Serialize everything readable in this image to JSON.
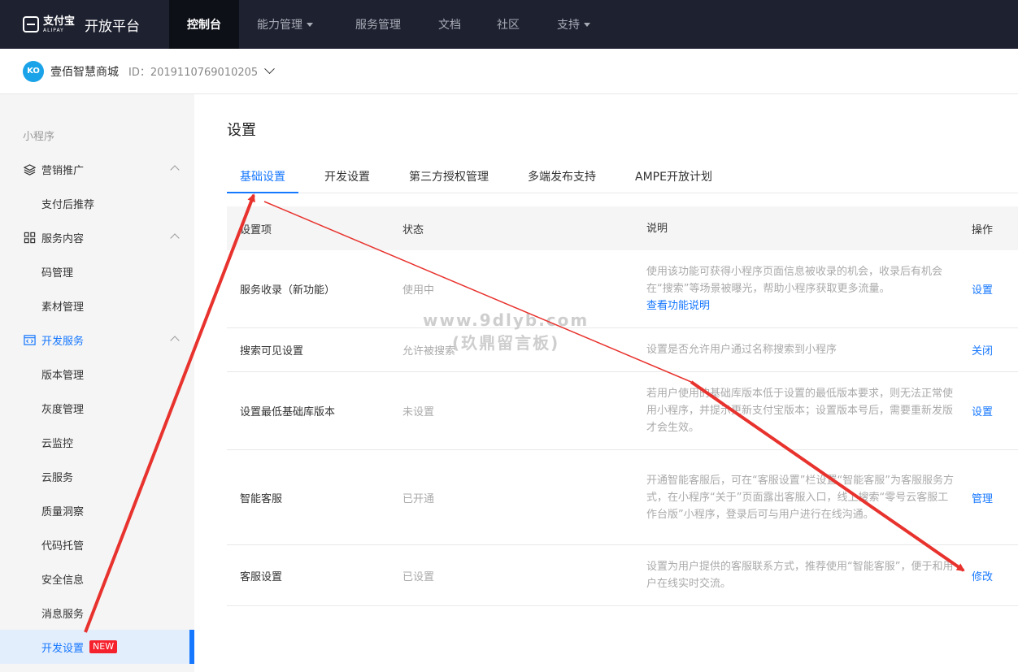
{
  "topnav": {
    "logo_cn": "支付宝",
    "logo_en": "ALIPAY",
    "platform_title": "开放平台",
    "items": [
      {
        "label": "控制台",
        "active": true,
        "dropdown": false
      },
      {
        "label": "能力管理",
        "active": false,
        "dropdown": true
      },
      {
        "label": "服务管理",
        "active": false,
        "dropdown": false
      },
      {
        "label": "文档",
        "active": false,
        "dropdown": false
      },
      {
        "label": "社区",
        "active": false,
        "dropdown": false
      },
      {
        "label": "支持",
        "active": false,
        "dropdown": true
      }
    ]
  },
  "appbar": {
    "avatar": "KO",
    "name": "壹佰智慧商城",
    "id": "ID：2019110769010205"
  },
  "sidebar": {
    "section": "小程序",
    "groups": [
      {
        "label": "营销推广",
        "items": [
          "支付后推荐"
        ]
      },
      {
        "label": "服务内容",
        "items": [
          "码管理",
          "素材管理"
        ]
      },
      {
        "label": "开发服务",
        "items": [
          "版本管理",
          "灰度管理",
          "云监控",
          "云服务",
          "质量洞察",
          "代码托管",
          "安全信息",
          "消息服务"
        ]
      }
    ],
    "active_item": "开发设置",
    "active_badge": "NEW"
  },
  "main": {
    "title": "设置",
    "tabs": [
      "基础设置",
      "开发设置",
      "第三方授权管理",
      "多端发布支持",
      "AMPE开放计划"
    ],
    "table": {
      "headers": [
        "设置项",
        "状态",
        "说明",
        "操作"
      ],
      "rows": [
        {
          "item": "服务收录（新功能）",
          "status": "使用中",
          "desc": "使用该功能可获得小程序页面信息被收录的机会，收录后有机会在“搜索”等场景被曝光，帮助小程序获取更多流量。",
          "desc_link": "查看功能说明",
          "action": "设置"
        },
        {
          "item": "搜索可见设置",
          "status": "允许被搜索",
          "desc": "设置是否允许用户通过名称搜索到小程序",
          "desc_link": "",
          "action": "关闭"
        },
        {
          "item": "设置最低基础库版本",
          "status": "未设置",
          "desc": "若用户使用的基础库版本低于设置的最低版本要求，则无法正常使用小程序，并提示更新支付宝版本；设置版本号后，需要重新发版才会生效。",
          "desc_link": "",
          "action": "设置"
        },
        {
          "item": "智能客服",
          "status": "已开通",
          "desc": "开通智能客服后，可在“客服设置”栏设置“智能客服”为客服服务方式，在小程序“关于”页面露出客服入口，线上搜索“零号云客服工作台版”小程序，登录后可与用户进行在线沟通。",
          "desc_link": "",
          "action": "管理"
        },
        {
          "item": "客服设置",
          "status": "已设置",
          "desc": "设置为用户提供的客服联系方式，推荐使用“智能客服”，便于和用户在线实时交流。",
          "desc_link": "",
          "action": "修改"
        }
      ]
    }
  },
  "watermark": {
    "line1": "www.9dlyb.com",
    "line2": "(玖鼎留言板)"
  },
  "colors": {
    "topnav_bg": "#1e2130",
    "accent": "#1677ff",
    "arrow": "#e8322d"
  }
}
